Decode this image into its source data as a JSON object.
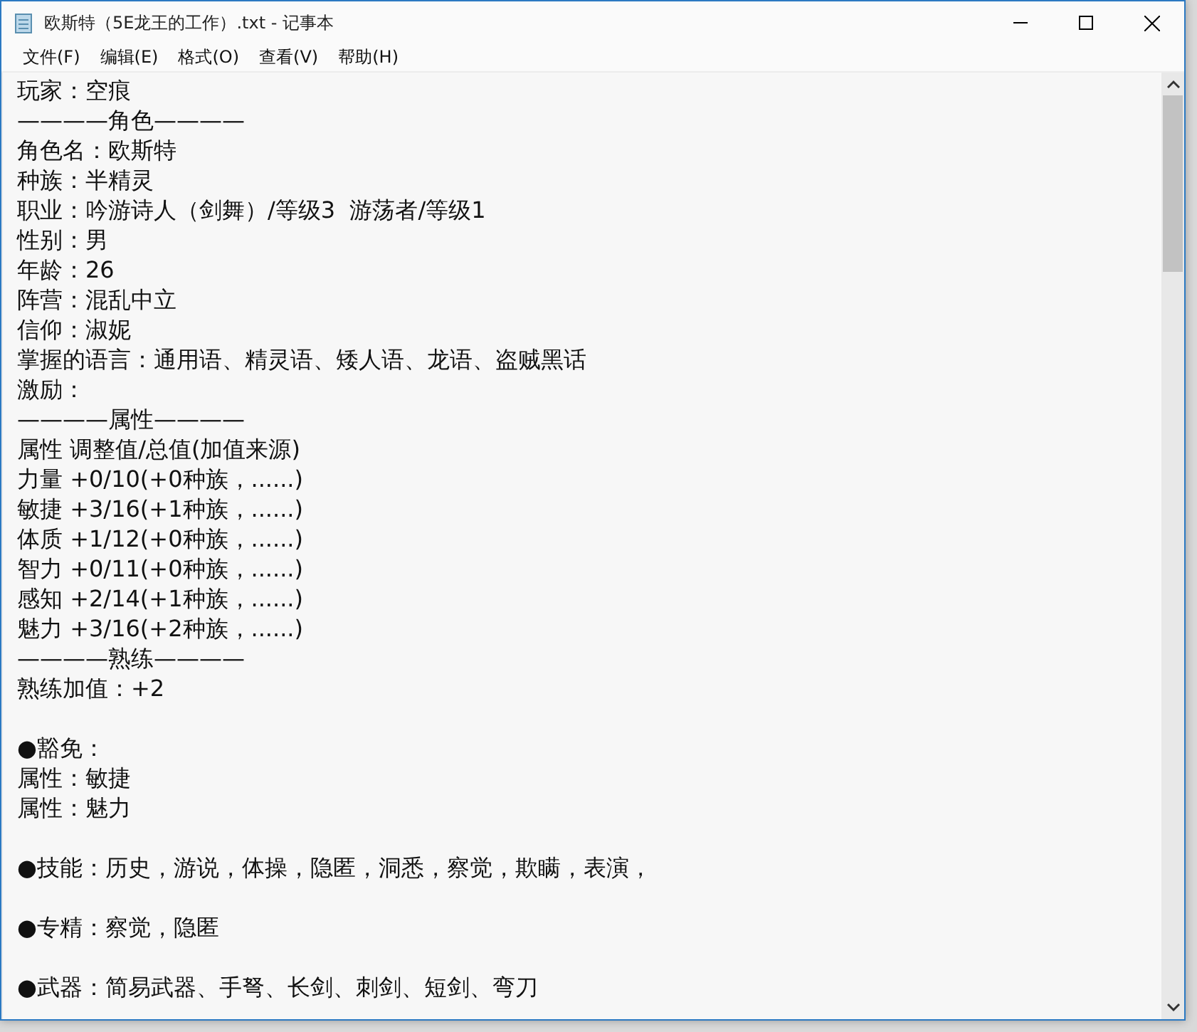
{
  "window": {
    "title": "欧斯特（5E龙王的工作）.txt - 记事本"
  },
  "menu": [
    "文件(F)",
    "编辑(E)",
    "格式(O)",
    "查看(V)",
    "帮助(H)"
  ],
  "lines": [
    {
      "kind": "text",
      "text": "玩家：空痕"
    },
    {
      "kind": "text",
      "text": "————角色————"
    },
    {
      "kind": "text",
      "text": "角色名：欧斯特"
    },
    {
      "kind": "text",
      "text": "种族：半精灵"
    },
    {
      "kind": "text",
      "text": "职业：吟游诗人（剑舞）/等级3  游荡者/等级1"
    },
    {
      "kind": "text",
      "text": "性别：男"
    },
    {
      "kind": "text",
      "text": "年龄：26"
    },
    {
      "kind": "text",
      "text": "阵营：混乱中立"
    },
    {
      "kind": "text",
      "text": "信仰：淑妮"
    },
    {
      "kind": "text",
      "text": "掌握的语言：通用语、精灵语、矮人语、龙语、盗贼黑话"
    },
    {
      "kind": "text",
      "text": "激励："
    },
    {
      "kind": "text",
      "text": "————属性————"
    },
    {
      "kind": "text",
      "text": "属性 调整值/总值(加值来源)"
    },
    {
      "kind": "text",
      "text": "力量 +0/10(+0种族，......)"
    },
    {
      "kind": "text",
      "text": "敏捷 +3/16(+1种族，......)"
    },
    {
      "kind": "text",
      "text": "体质 +1/12(+0种族，......)"
    },
    {
      "kind": "text",
      "text": "智力 +0/11(+0种族，......)"
    },
    {
      "kind": "text",
      "text": "感知 +2/14(+1种族，......)"
    },
    {
      "kind": "text",
      "text": "魅力 +3/16(+2种族，......)"
    },
    {
      "kind": "text",
      "text": "————熟练————"
    },
    {
      "kind": "text",
      "text": "熟练加值：+2"
    },
    {
      "kind": "blank"
    },
    {
      "kind": "text",
      "text": "●豁免："
    },
    {
      "kind": "text",
      "text": "属性：敏捷"
    },
    {
      "kind": "text",
      "text": "属性：魅力"
    },
    {
      "kind": "blank"
    },
    {
      "kind": "text",
      "text": "●技能：历史，游说，体操，隐匿，洞悉，察觉，欺瞒，表演，"
    },
    {
      "kind": "blank"
    },
    {
      "kind": "text",
      "text": "●专精：察觉，隐匿"
    },
    {
      "kind": "blank"
    },
    {
      "kind": "text",
      "text": "●武器：简易武器、手弩、长剑、刺剑、短剑、弯刀"
    }
  ]
}
